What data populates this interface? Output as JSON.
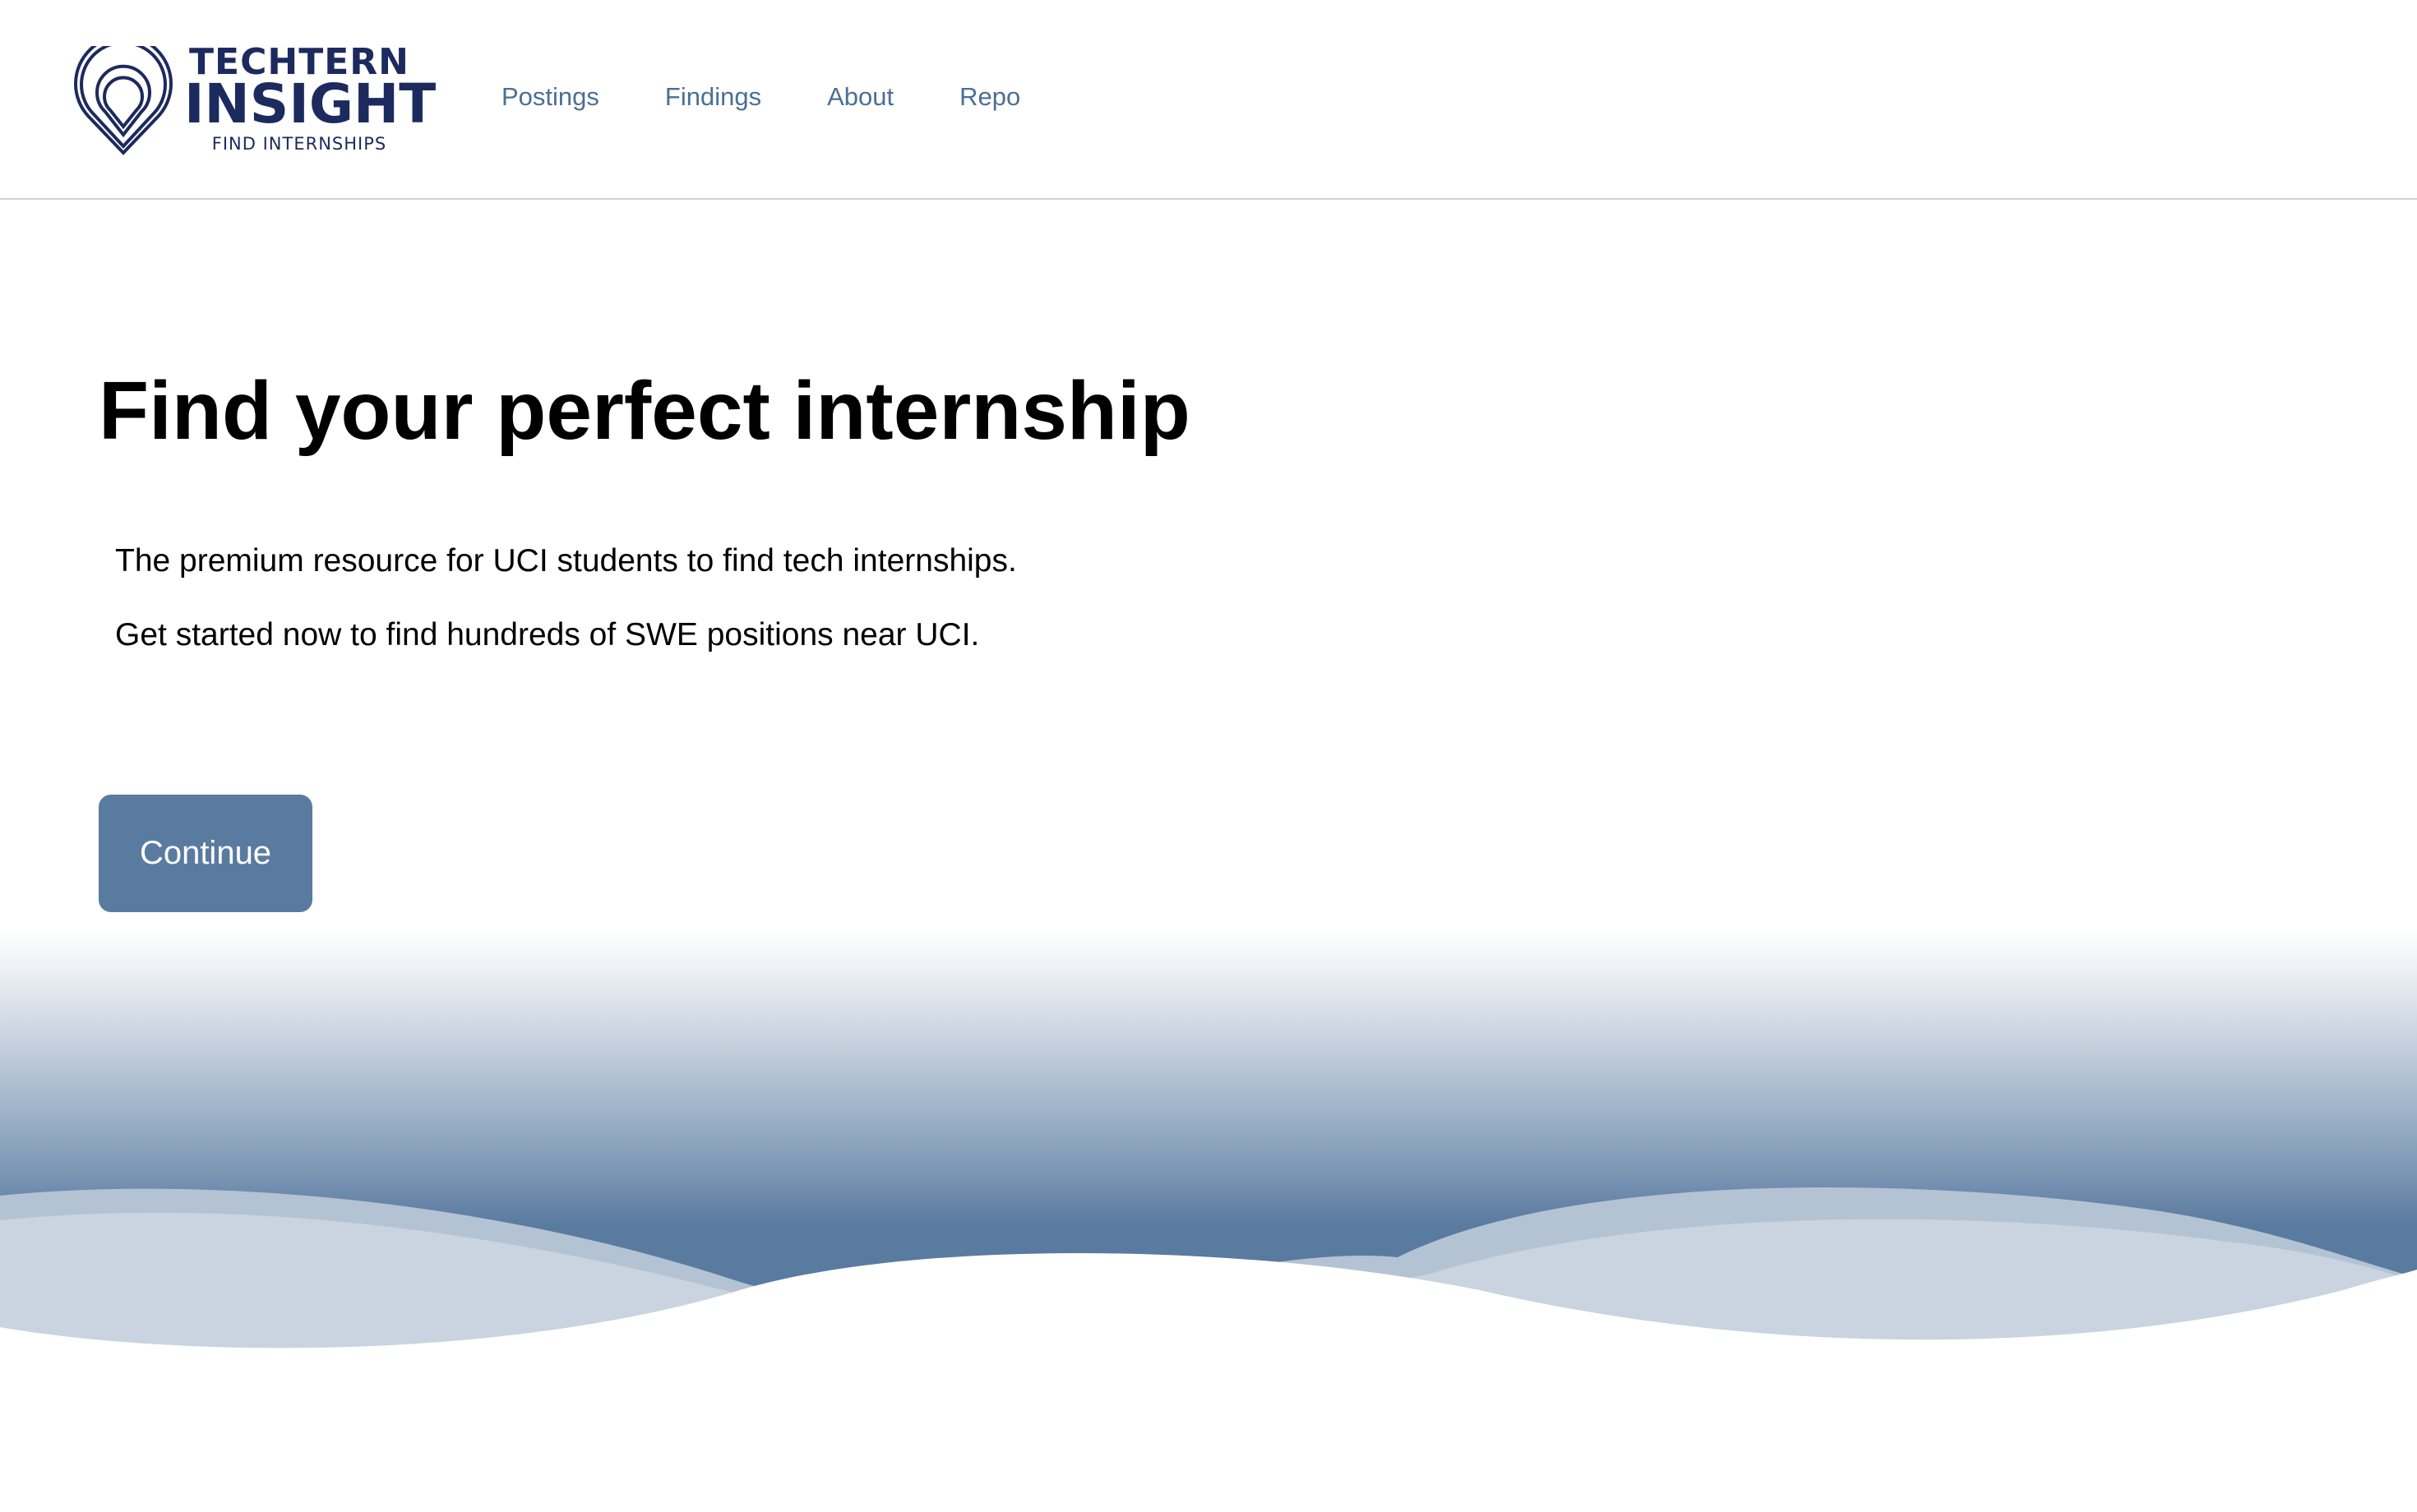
{
  "brand": {
    "logo_icon": "location-pin-icon",
    "line1": "TECHTERN",
    "line2": "INSIGHT",
    "tagline": "FIND INTERNSHIPS",
    "color": "#1d2a5e"
  },
  "nav": {
    "items": [
      {
        "label": "Postings"
      },
      {
        "label": "Findings"
      },
      {
        "label": "About"
      },
      {
        "label": "Repo"
      }
    ],
    "color": "#4b6f94"
  },
  "hero": {
    "title": "Find your perfect internship",
    "line1": "The premium resource for UCI students to find tech internships.",
    "line2": "Get started now to find hundreds of SWE positions near UCI.",
    "cta_label": "Continue",
    "cta_color": "#5a7ba0"
  },
  "theme": {
    "wave_dark": "#5a7ba0",
    "wave_light": "#c9d4e0",
    "wave_mid": "#b4c3d4"
  }
}
